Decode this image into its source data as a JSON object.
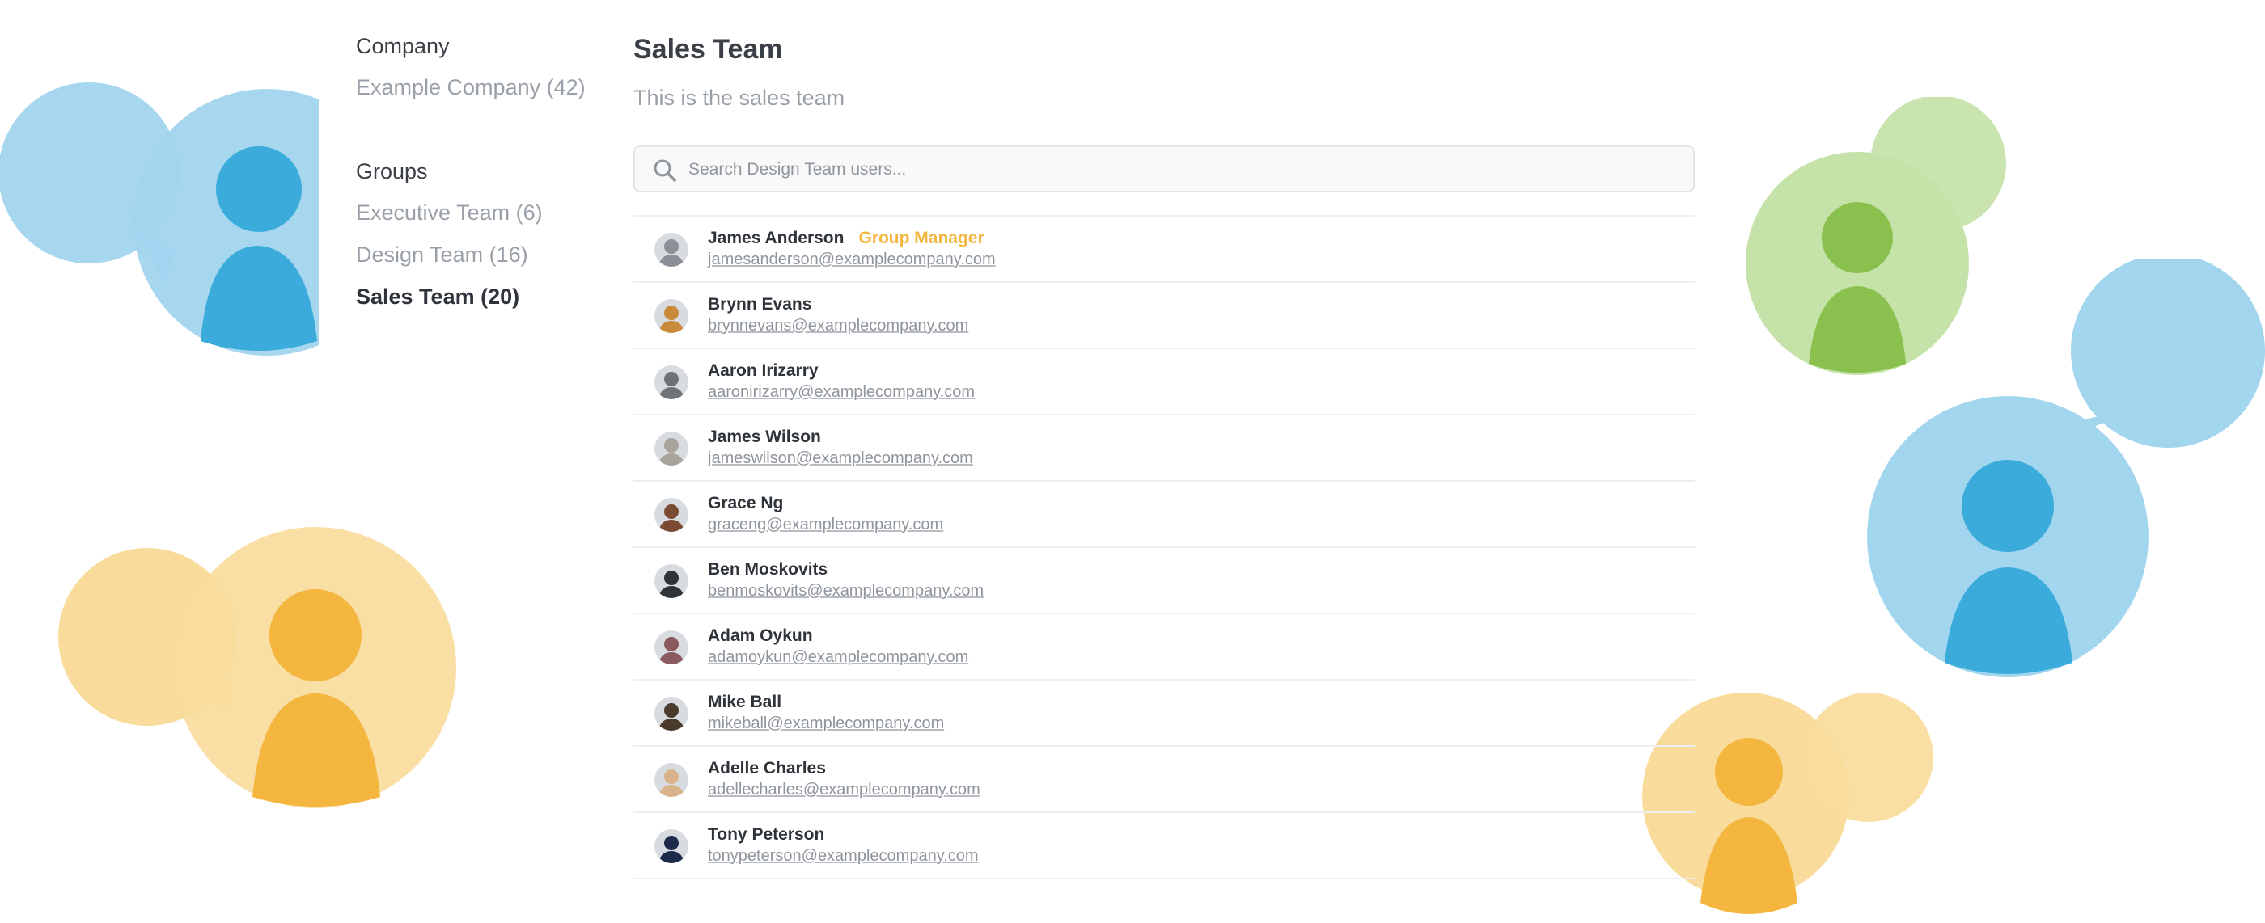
{
  "sidebar": {
    "company_heading": "Company",
    "company_link": "Example Company (42)",
    "groups_heading": "Groups",
    "groups": [
      {
        "label": "Executive Team (6)",
        "active": false
      },
      {
        "label": "Design Team (16)",
        "active": false
      },
      {
        "label": "Sales Team (20)",
        "active": true
      }
    ]
  },
  "main": {
    "title": "Sales Team",
    "subtitle": "This is the sales team",
    "search": {
      "placeholder": "Search Design Team users...",
      "value": ""
    }
  },
  "users": [
    {
      "name": "James Anderson",
      "badge": "Group Manager",
      "email": "jamesanderson@examplecompany.com",
      "avatar_color": "#8c8f96"
    },
    {
      "name": "Brynn Evans",
      "badge": "",
      "email": "brynnevans@examplecompany.com",
      "avatar_color": "#c98a3a"
    },
    {
      "name": "Aaron Irizarry",
      "badge": "",
      "email": "aaronirizarry@examplecompany.com",
      "avatar_color": "#6e7378"
    },
    {
      "name": "James Wilson",
      "badge": "",
      "email": "jameswilson@examplecompany.com",
      "avatar_color": "#a8a39b"
    },
    {
      "name": "Grace Ng",
      "badge": "",
      "email": "graceng@examplecompany.com",
      "avatar_color": "#7a4a32"
    },
    {
      "name": "Ben Moskovits",
      "badge": "",
      "email": "benmoskovits@examplecompany.com",
      "avatar_color": "#2e3438"
    },
    {
      "name": "Adam Oykun",
      "badge": "",
      "email": "adamoykun@examplecompany.com",
      "avatar_color": "#8a5a5e"
    },
    {
      "name": "Mike Ball",
      "badge": "",
      "email": "mikeball@examplecompany.com",
      "avatar_color": "#4a3a2c"
    },
    {
      "name": "Adelle Charles",
      "badge": "",
      "email": "adellecharles@examplecompany.com",
      "avatar_color": "#d9b48a"
    },
    {
      "name": "Tony Peterson",
      "badge": "",
      "email": "tonypeterson@examplecompany.com",
      "avatar_color": "#1e2a4a"
    }
  ],
  "colors": {
    "accent_badge": "#f4b63f",
    "blue_light": "#a2d5ee",
    "blue_dark": "#3aabdb",
    "green_light": "#c5e2a8",
    "green_dark": "#8ac14e",
    "yellow_light": "#f9dc9c",
    "yellow_dark": "#f4b63f"
  },
  "decorations": [
    {
      "color": "blue",
      "icon": "person-speech-bubble-icon"
    },
    {
      "color": "yellow",
      "icon": "person-speech-bubble-icon"
    },
    {
      "color": "green",
      "icon": "person-speech-bubble-icon"
    },
    {
      "color": "blue",
      "icon": "person-speech-bubble-icon"
    },
    {
      "color": "yellow",
      "icon": "person-speech-bubble-icon"
    }
  ]
}
